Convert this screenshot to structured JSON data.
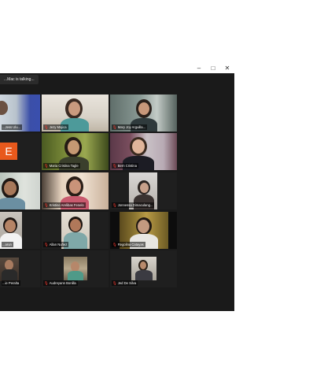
{
  "window": {
    "minimize_icon": "minimize-icon",
    "maximize_icon": "maximize-icon",
    "close_icon": "close-icon"
  },
  "banner": {
    "talking": "...Mac is talking..."
  },
  "participants": [
    {
      "name": "...Jess Ulu...",
      "mic_muted": false
    },
    {
      "name": "Jezy Mojica",
      "mic_muted": true
    },
    {
      "name": "Mary Joy Arguilla...",
      "mic_muted": true
    },
    {
      "name": "",
      "mic_muted": false,
      "avatar_letter": "E",
      "avatar_color": "#e8591c"
    },
    {
      "name": "Maria Cristina Tagle",
      "mic_muted": true
    },
    {
      "name": "Bern Cristina",
      "mic_muted": true
    },
    {
      "name": "",
      "mic_muted": false
    },
    {
      "name": "Kristine Arelibas Fenelo",
      "mic_muted": true
    },
    {
      "name": "Jonnessa Dimaculang...",
      "mic_muted": true
    },
    {
      "name": "...arun",
      "mic_muted": false
    },
    {
      "name": "Allan Nuñez",
      "mic_muted": true
    },
    {
      "name": "Regolina Catayas",
      "mic_muted": true
    },
    {
      "name": "...ie Peralta",
      "mic_muted": false
    },
    {
      "name": "Audreyann Bonilla",
      "mic_muted": true
    },
    {
      "name": "Jed De Silva",
      "mic_muted": true
    }
  ],
  "colors": {
    "background": "#1a1a1a",
    "mic_muted": "#ff3b30"
  }
}
